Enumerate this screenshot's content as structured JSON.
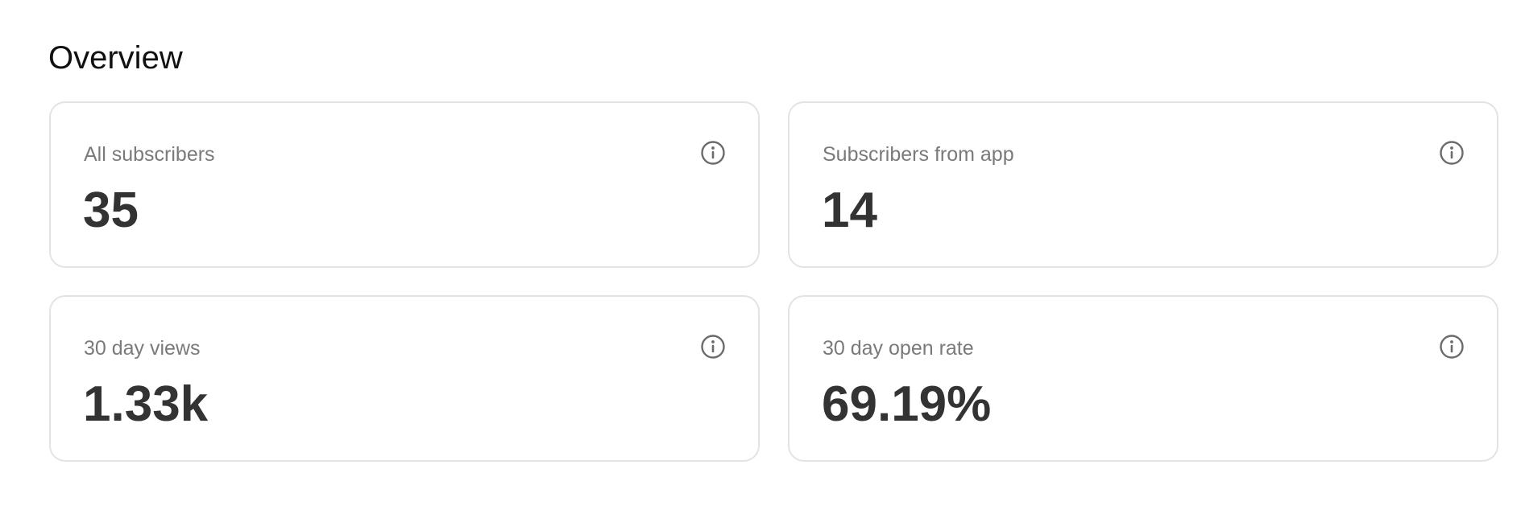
{
  "header": {
    "title": "Overview"
  },
  "cards": [
    {
      "label": "All subscribers",
      "value": "35",
      "icon": "info-icon"
    },
    {
      "label": "Subscribers from app",
      "value": "14",
      "icon": "info-icon"
    },
    {
      "label": "30 day views",
      "value": "1.33k",
      "icon": "info-icon"
    },
    {
      "label": "30 day open rate",
      "value": "69.19%",
      "icon": "info-icon"
    }
  ],
  "colors": {
    "title": "#111111",
    "label": "#7a7a7a",
    "value": "#333333",
    "border": "#e3e3e3",
    "icon": "#6b6b6b"
  }
}
